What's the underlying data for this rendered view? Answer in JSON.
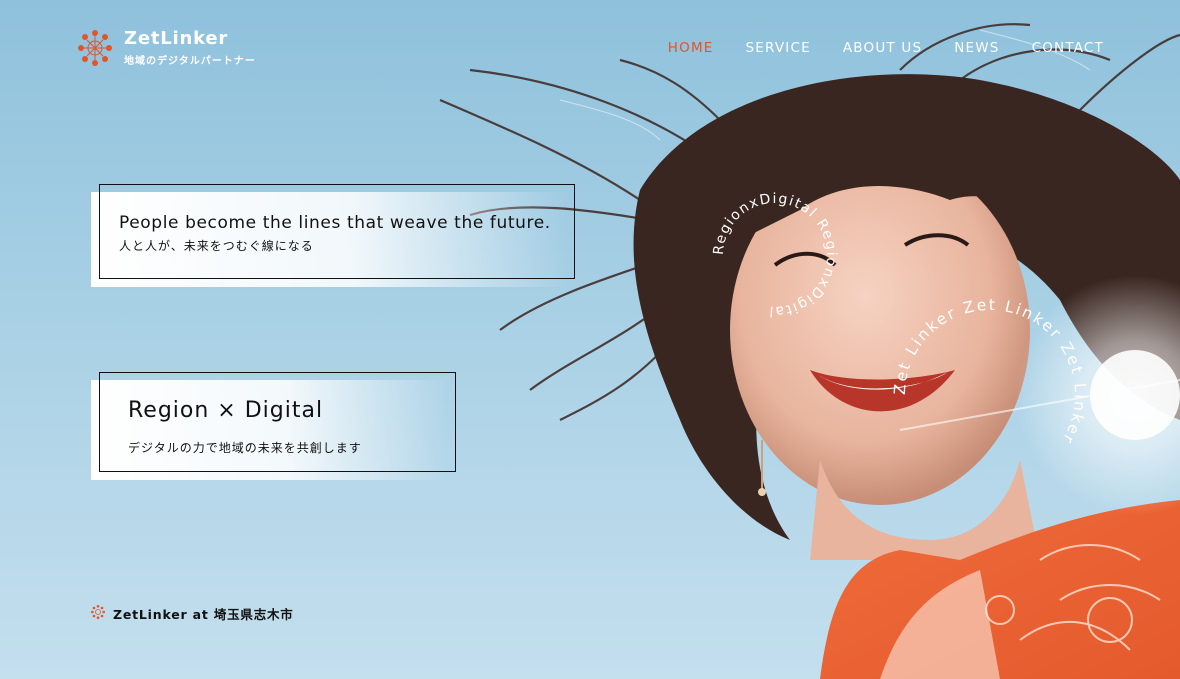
{
  "header": {
    "logo_name": "ZetLinker",
    "logo_tagline": "地域のデジタルパートナー"
  },
  "nav": {
    "items": [
      {
        "label": "HOME",
        "active": true
      },
      {
        "label": "SERVICE",
        "active": false
      },
      {
        "label": "ABOUT US",
        "active": false
      },
      {
        "label": "NEWS",
        "active": false
      },
      {
        "label": "CONTACT",
        "active": false
      }
    ]
  },
  "hero": {
    "tagline_en": "People become the lines that weave the future.",
    "tagline_ja": "人と人が、未来をつむぐ線になる",
    "region_title": "Region × Digital",
    "region_sub": "デジタルの力で地域の未来を共創します",
    "location": "ZetLinker at 埼玉県志木市",
    "circle_small": "RegionxDigital RegionxDigital ",
    "circle_large": "Zet Linker Zet Linker Zet Linker "
  },
  "colors": {
    "accent": "#e2542a",
    "sky": "#a8d0e5",
    "text": "#111111"
  },
  "icons": {
    "logo": "sunburst-logo-icon",
    "location": "sunburst-small-icon"
  }
}
